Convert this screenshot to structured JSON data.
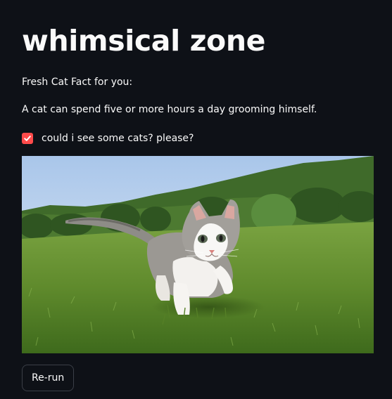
{
  "title": "whimsical zone",
  "intro_text": "Fresh Cat Fact for you:",
  "cat_fact": "A cat can spend five or more hours a day grooming himself.",
  "checkbox": {
    "label": "could i see some cats? please?",
    "checked": true,
    "accent_color": "#ff4b4b"
  },
  "image": {
    "subject": "kitten-walking-on-grass-photo"
  },
  "rerun_button": {
    "label": "Re-run"
  },
  "colors": {
    "background": "#0e1117",
    "text": "#fafafa",
    "button_border": "#3b3f47"
  }
}
